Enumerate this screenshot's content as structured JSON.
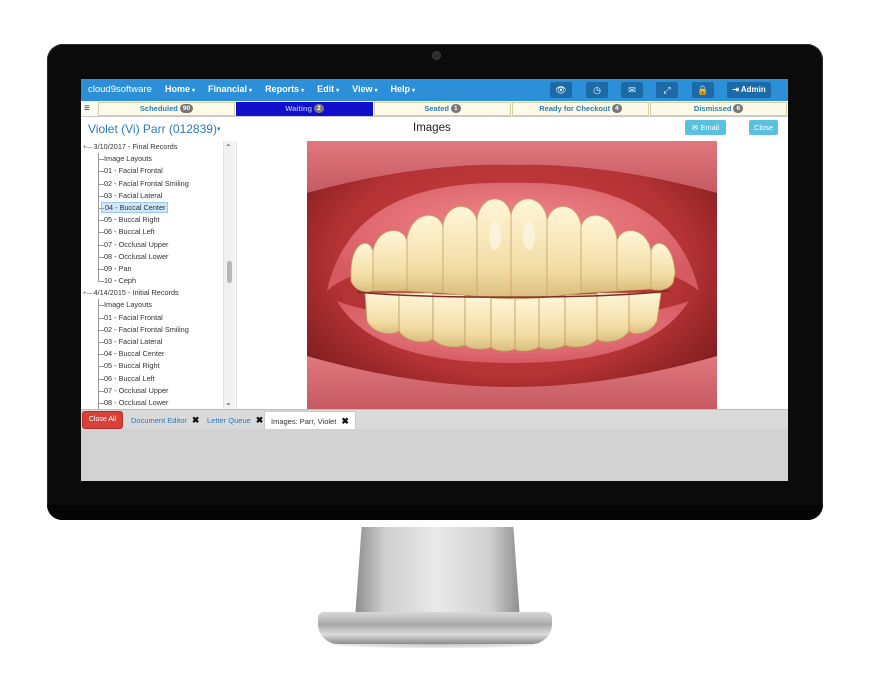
{
  "app": {
    "brand": "cloud9software"
  },
  "nav": {
    "menus": [
      {
        "label": "Home",
        "caret": "▾"
      },
      {
        "label": "Financial",
        "caret": "▾"
      },
      {
        "label": "Reports",
        "caret": "▾"
      },
      {
        "label": "Edit",
        "caret": "▾"
      },
      {
        "label": "View",
        "caret": "▾"
      },
      {
        "label": "Help",
        "caret": "▾"
      }
    ],
    "tools": [
      {
        "icon": "eye-icon",
        "glyph": "👁"
      },
      {
        "icon": "clock-icon",
        "glyph": "◷"
      },
      {
        "icon": "envelope-icon",
        "glyph": "✉"
      },
      {
        "icon": "expand-icon",
        "glyph": "⤢"
      },
      {
        "icon": "lock-icon",
        "glyph": "🔒"
      }
    ],
    "admin": {
      "glyph": "⇥",
      "label": "Admin"
    }
  },
  "status_tabs": [
    {
      "label": "Scheduled",
      "count": "90"
    },
    {
      "label": "Waiting",
      "count": "2",
      "active": true
    },
    {
      "label": "Seated",
      "count": "1"
    },
    {
      "label": "Ready for Checkout",
      "count": "4"
    },
    {
      "label": "Dismissed",
      "count": "6"
    }
  ],
  "header": {
    "patient": "Violet (Vi) Parr (012839)",
    "patient_caret": "▾",
    "title": "Images",
    "email_label": "Email",
    "email_glyph": "✉",
    "close_label": "Close"
  },
  "tree": {
    "groups": [
      {
        "label": "3/10/2017 - Final Records",
        "items": [
          "Image Layouts",
          "01 - Facial Frontal",
          "02 - Facial Frontal Smiling",
          "03 - Facial Lateral",
          "04 - Buccal Center",
          "05 - Buccal Right",
          "06 - Buccal Left",
          "07 - Occlusal Upper",
          "08 - Occlusal Lower",
          "09 - Pan",
          "10 - Ceph"
        ],
        "selected": "04 - Buccal Center"
      },
      {
        "label": "4/14/2015 - Initial Records",
        "items": [
          "Image Layouts",
          "01 - Facial Frontal",
          "02 - Facial Frontal Smiling",
          "03 - Facial Lateral",
          "04 - Buccal Center",
          "05 - Buccal Right",
          "06 - Buccal Left",
          "07 - Occlusal Upper",
          "08 - Occlusal Lower"
        ]
      }
    ]
  },
  "tabbar": {
    "close_all": "Close All",
    "tabs": [
      {
        "label": "Document Editor",
        "close": "✖"
      },
      {
        "label": "Letter Queue",
        "close": "✖"
      },
      {
        "label": "Images: Parr, Violet",
        "close": "✖",
        "active": true
      }
    ]
  },
  "colors": {
    "navbar": "#2d8fd8",
    "accent_link": "#2d7ab8",
    "active_status": "#1010cc",
    "info_button": "#5bc0de",
    "danger_button": "#d9403a"
  }
}
